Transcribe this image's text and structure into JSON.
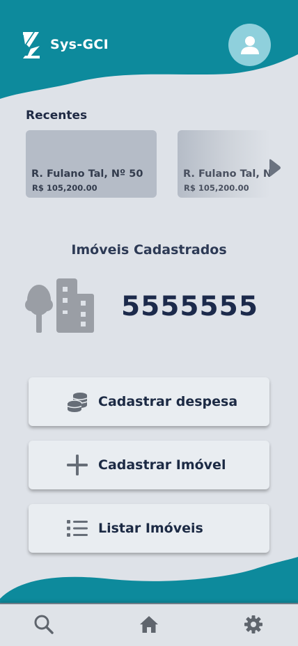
{
  "header": {
    "app_name": "Sys-GCI",
    "logo_icon": "sys-gci-logo-icon",
    "avatar_icon": "user-icon"
  },
  "recentes": {
    "title": "Recentes",
    "items": [
      {
        "address": "R. Fulano Tal, Nº 50",
        "price": "R$ 105,200.00"
      },
      {
        "address": "R. Fulano Tal, N",
        "price": "R$ 105,200.00"
      }
    ],
    "next_icon": "chevron-right-icon"
  },
  "stats": {
    "title": "Imóveis Cadastrados",
    "count": "5555555",
    "illustration": "buildings-tree-icon"
  },
  "actions": [
    {
      "label": "Cadastrar despesa",
      "icon": "coins-icon"
    },
    {
      "label": "Cadastrar Imóvel",
      "icon": "plus-icon"
    },
    {
      "label": "Listar Imóveis",
      "icon": "list-icon"
    }
  ],
  "bottom_nav": {
    "items": [
      {
        "icon": "search-icon"
      },
      {
        "icon": "home-icon"
      },
      {
        "icon": "settings-icon"
      }
    ]
  },
  "colors": {
    "teal": "#0d8a9c",
    "background": "#dee2e8",
    "card": "#b5bcc7",
    "text_dark": "#1f2a44",
    "icon_gray": "#666d77"
  }
}
